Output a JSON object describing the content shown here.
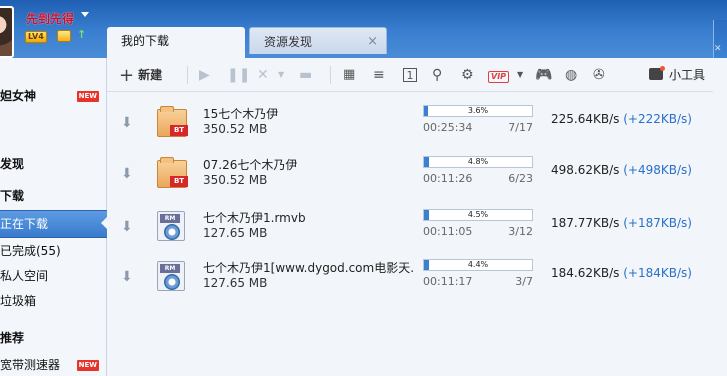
{
  "header": {
    "username": "先到先得",
    "level": "LV4"
  },
  "tabs": [
    {
      "label": "我的下载",
      "active": true
    },
    {
      "label": "资源发现",
      "active": false,
      "close": "×"
    }
  ],
  "sidebar": {
    "items": [
      {
        "label": "妲女神",
        "badge": "NEW"
      },
      {
        "label": "发现"
      },
      {
        "label": "下载"
      },
      {
        "label": "正在下载",
        "active": true
      },
      {
        "label": "已完成(55)"
      },
      {
        "label": "私人空间"
      },
      {
        "label": "垃圾箱"
      },
      {
        "label": "推荐"
      },
      {
        "label": "宽带测速器",
        "badge": "NEW"
      }
    ]
  },
  "toolbar": {
    "new_label": "新建",
    "tools_label": "小工具",
    "vip_label": "VIP"
  },
  "downloads": [
    {
      "name": "15七个木乃伊",
      "size": "350.52 MB",
      "type": "bt",
      "progress_text": "3.6%",
      "progress": 0.036,
      "elapsed": "00:25:34",
      "pieces": "7/17",
      "speed": "225.64KB/s",
      "speed_up": "(+222KB/s)"
    },
    {
      "name": "07.26七个木乃伊",
      "size": "350.52 MB",
      "type": "bt",
      "progress_text": "4.8%",
      "progress": 0.048,
      "elapsed": "00:11:26",
      "pieces": "6/23",
      "speed": "498.62KB/s",
      "speed_up": "(+498KB/s)"
    },
    {
      "name": "七个木乃伊1.rmvb",
      "size": "127.65 MB",
      "type": "rm",
      "progress_text": "4.5%",
      "progress": 0.045,
      "elapsed": "00:11:05",
      "pieces": "3/12",
      "speed": "187.77KB/s",
      "speed_up": "(+187KB/s)"
    },
    {
      "name": "七个木乃伊1[www.dygod.com电影天...",
      "size": "127.65 MB",
      "type": "rm",
      "progress_text": "4.4%",
      "progress": 0.044,
      "elapsed": "00:11:17",
      "pieces": "3/7",
      "speed": "184.62KB/s",
      "speed_up": "(+184KB/s)"
    }
  ]
}
